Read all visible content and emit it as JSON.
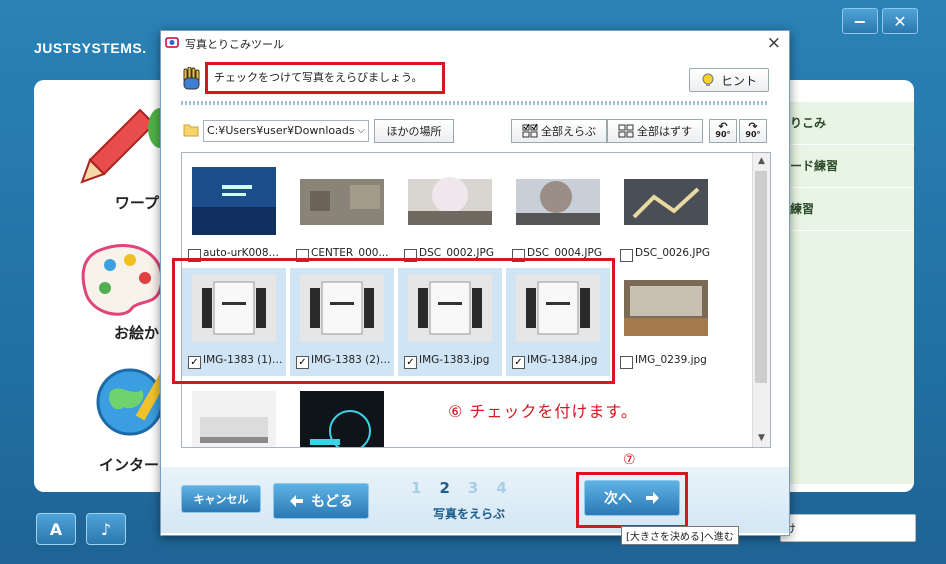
{
  "background_app": {
    "brand": "JUSTSYSTEMS.",
    "minimize_label": "−",
    "close_label": "✕",
    "tiles": [
      {
        "label": "ワープロ"
      },
      {
        "label": "お絵かき"
      },
      {
        "label": "インターネ"
      }
    ],
    "right_items": [
      {
        "label": "りこみ"
      },
      {
        "label": "ード練習"
      },
      {
        "label": "練習"
      }
    ],
    "bottom_field_text": "け"
  },
  "dialog": {
    "title": "写真とりこみツール",
    "close_label": "×",
    "instruction": "チェックをつけて写真をえらびましょう。",
    "hint_label": "ヒント",
    "path": "C:¥Users¥user¥Downloads",
    "other_place_label": "ほかの場所",
    "select_all_label": "全部えらぶ",
    "deselect_all_label": "全部はずす",
    "rotate_left_label": "90°",
    "rotate_right_label": "90°",
    "photos": [
      {
        "name": "auto-urK008p...",
        "checked": false
      },
      {
        "name": "CENTER_000...",
        "checked": false
      },
      {
        "name": "DSC_0002.JPG",
        "checked": false
      },
      {
        "name": "DSC_0004.JPG",
        "checked": false
      },
      {
        "name": "DSC_0026.JPG",
        "checked": false
      },
      {
        "name": "IMG-1383 (1)....",
        "checked": true
      },
      {
        "name": "IMG-1383 (2)....",
        "checked": true
      },
      {
        "name": "IMG-1383.jpg",
        "checked": true
      },
      {
        "name": "IMG-1384.jpg",
        "checked": true
      },
      {
        "name": "IMG_0239.jpg",
        "checked": false
      }
    ],
    "check_mark": "✓",
    "annotation_6": "⑥ チェックを付けます。",
    "annotation_7": "⑦"
  },
  "footer": {
    "cancel_label": "キャンセル",
    "back_label": "もどる",
    "steps": [
      "1",
      "2",
      "3",
      "4"
    ],
    "active_step": "2",
    "step_label": "写真をえらぶ",
    "next_label": "次へ",
    "tooltip": "[大きさを決める]へ進む"
  },
  "colors": {
    "annotation_red": "#d9151d",
    "accent_blue": "#2b79b5",
    "selected_cell": "#cfe4f5"
  }
}
